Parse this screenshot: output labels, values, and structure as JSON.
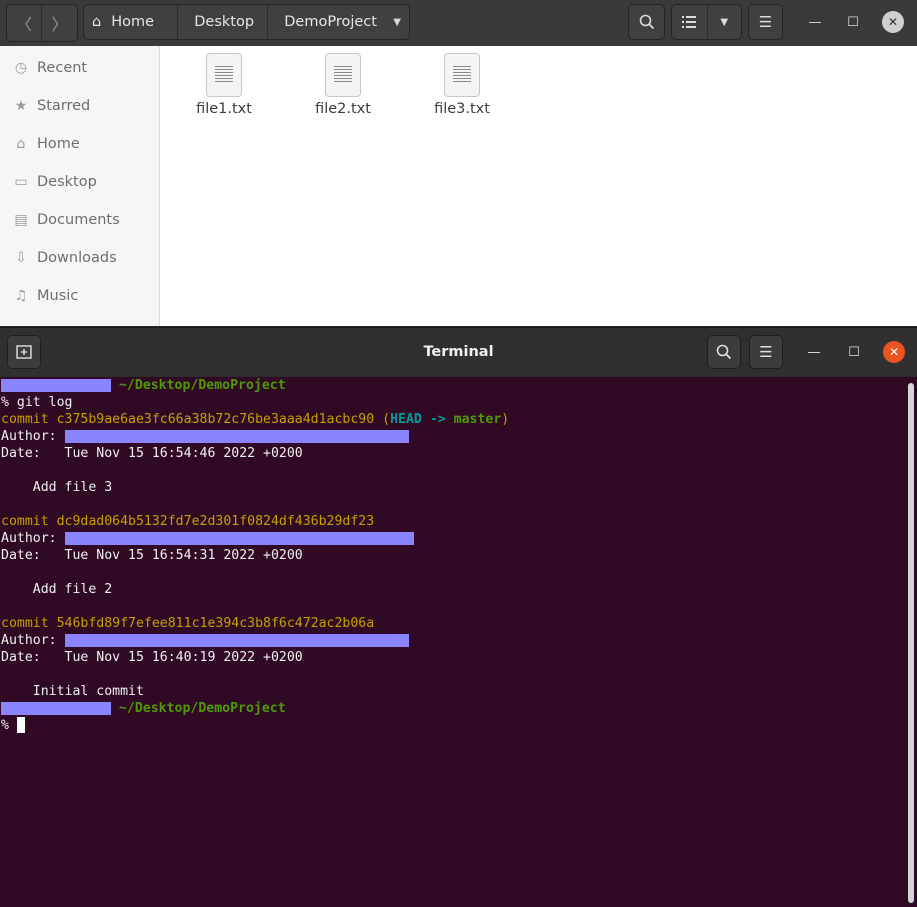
{
  "file_manager": {
    "breadcrumbs": [
      "Home",
      "Desktop",
      "DemoProject"
    ],
    "sidebar": [
      {
        "label": "Recent",
        "icon": "recent-icon"
      },
      {
        "label": "Starred",
        "icon": "star-icon"
      },
      {
        "label": "Home",
        "icon": "home-icon"
      },
      {
        "label": "Desktop",
        "icon": "desktop-icon"
      },
      {
        "label": "Documents",
        "icon": "documents-icon"
      },
      {
        "label": "Downloads",
        "icon": "downloads-icon"
      },
      {
        "label": "Music",
        "icon": "music-icon"
      }
    ],
    "files": [
      {
        "name": "file1.txt"
      },
      {
        "name": "file2.txt"
      },
      {
        "name": "file3.txt"
      }
    ]
  },
  "terminal": {
    "title": "Terminal",
    "prompt_path": "~/Desktop/DemoProject",
    "prompt_symbol": "%",
    "command": " git log",
    "commits": [
      {
        "prefix": "commit",
        "hash": "c375b9ae6ae3fc66a38b72c76be3aaa4d1acbc90",
        "ref_open": "(",
        "ref_head": "HEAD",
        "ref_arrow": "->",
        "ref_branch": "master",
        "ref_close": ")",
        "author_label": "Author:",
        "date_label": "Date:",
        "date": "Tue Nov 15 16:54:46 2022 +0200",
        "message": "Add file 3"
      },
      {
        "prefix": "commit",
        "hash": "dc9dad064b5132fd7e2d301f0824df436b29df23",
        "author_label": "Author:",
        "date_label": "Date:",
        "date": "Tue Nov 15 16:54:31 2022 +0200",
        "message": "Add file 2"
      },
      {
        "prefix": "commit",
        "hash": "546bfd89f7efee811c1e394c3b8f6c472ac2b06a",
        "author_label": "Author:",
        "date_label": "Date:",
        "date": "Tue Nov 15 16:40:19 2022 +0200",
        "message": "Initial commit"
      }
    ]
  },
  "colors": {
    "terminal_bg": "#300a24",
    "commit_yellow": "#c4a000",
    "head_cyan": "#06989a",
    "branch_green": "#4e9a06",
    "redaction": "#8b84ff",
    "close_orange": "#e95420"
  }
}
